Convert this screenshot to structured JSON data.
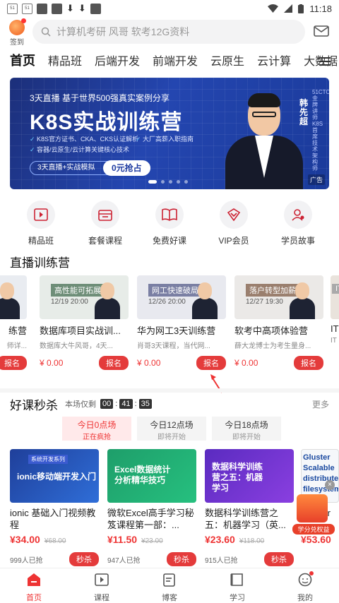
{
  "status": {
    "time": "11:18"
  },
  "header": {
    "signin_label": "签到",
    "search_placeholder": "计算机考研 风哥 软考12G资料"
  },
  "tabs": [
    "首页",
    "精品班",
    "后端开发",
    "前端开发",
    "云原生",
    "云计算",
    "大数据"
  ],
  "banner": {
    "tagline": "3天直播 基于世界500强真实案例分享",
    "title": "K8S实战训练营",
    "features": [
      "K8S官方证书、CKA、CKS认证解析",
      "容器/云原生/云计算关键核心技术",
      "大厂高薪入职指南"
    ],
    "pill": "3天直播+实战模拟",
    "cta": "0元抢占",
    "name": "韩先超",
    "role": "51CTO金牌讲师 K8S首席技术架构师",
    "ad": "广告"
  },
  "quick": [
    {
      "label": "精品班",
      "icon": "video-course-icon"
    },
    {
      "label": "套餐课程",
      "icon": "package-icon"
    },
    {
      "label": "免费好课",
      "icon": "book-icon"
    },
    {
      "label": "VIP会员",
      "icon": "vip-icon"
    },
    {
      "label": "学员故事",
      "icon": "student-icon"
    }
  ],
  "live": {
    "title": "直播训练营",
    "cards": [
      {
        "tag": "",
        "date": "",
        "title": "练营",
        "sub": "师详...",
        "price": "",
        "btn": "报名"
      },
      {
        "tag": "高性能可拓展",
        "date": "12/19 20:00",
        "title": "数据库项目实战训...",
        "sub": "数据库大牛风哥，4天...",
        "price": "¥ 0.00",
        "btn": "报名"
      },
      {
        "tag": "网工快速破局",
        "date": "12/26 20:00",
        "title": "华为网工3天训练营",
        "sub": "肖哥3天课程，当代网...",
        "price": "¥ 0.00",
        "btn": "报名"
      },
      {
        "tag": "落户转型加薪",
        "date": "12/27 19:30",
        "title": "软考中高项体验营",
        "sub": "薛大龙博士为考生量身...",
        "price": "¥ 0.00",
        "btn": "报名"
      },
      {
        "tag": "IT",
        "date": "",
        "title": "IT",
        "sub": "IT",
        "price": "",
        "btn": ""
      }
    ]
  },
  "flash": {
    "title": "好课秒杀",
    "ends": "本场仅剩",
    "countdown": [
      "00",
      "41",
      "35"
    ],
    "more": "更多",
    "slots": [
      {
        "time": "今日0点场",
        "state": "正在疯抢"
      },
      {
        "time": "今日12点场",
        "state": "即将开始"
      },
      {
        "time": "今日18点场",
        "state": "即将开始"
      }
    ],
    "deals": [
      {
        "img": "ionic移动端开发入门",
        "img_tag": "系统开发系列",
        "title": "ionic 基础入门视频教程",
        "now": "¥34.00",
        "old": "¥68.00",
        "sold": "999人已抢",
        "btn": "秒杀"
      },
      {
        "img": "Excel数据统计分析精华技巧",
        "img_tag": "",
        "title": "微软Excel高手学习秘笈课程第一部：...",
        "now": "¥11.50",
        "old": "¥23.00",
        "sold": "947人已抢",
        "btn": "秒杀"
      },
      {
        "img": "数据科学训练营之五：机器学习",
        "img_tag": "",
        "title": "数据科学训练营之五：机器学习（英...",
        "now": "¥23.60",
        "old": "¥118.00",
        "sold": "915人已抢",
        "btn": "秒杀"
      },
      {
        "img": "Gluster Scalable distributed filesystem",
        "img_tag": "",
        "title": "Gluster",
        "now": "¥53.60",
        "old": "",
        "sold": "",
        "btn": ""
      }
    ],
    "gift_label": "学分兑权益"
  },
  "bottom_nav": [
    {
      "label": "首页",
      "icon": "home-icon"
    },
    {
      "label": "课程",
      "icon": "course-icon"
    },
    {
      "label": "博客",
      "icon": "blog-icon"
    },
    {
      "label": "学习",
      "icon": "study-icon"
    },
    {
      "label": "我的",
      "icon": "profile-icon"
    }
  ],
  "colors": {
    "accent": "#e43b3b",
    "banner": "#2446b0"
  }
}
